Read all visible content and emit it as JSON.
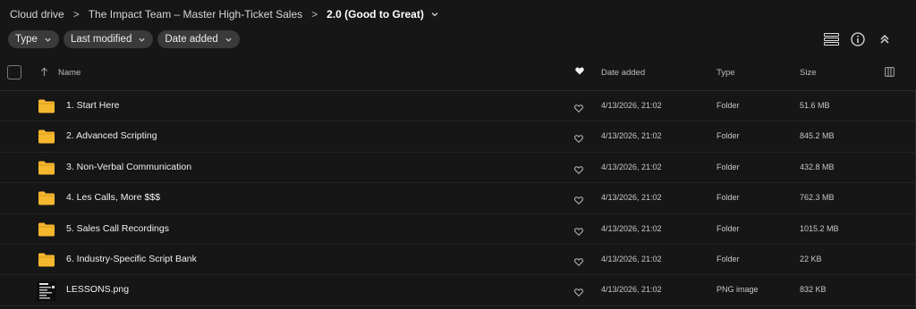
{
  "breadcrumb": {
    "items": [
      "Cloud drive",
      "The Impact Team – Master High-Ticket Sales"
    ],
    "current": "2.0 (Good to Great)",
    "separator": ">"
  },
  "filters": [
    {
      "label": "Type"
    },
    {
      "label": "Last modified"
    },
    {
      "label": "Date added"
    }
  ],
  "toolbar": {
    "icons": [
      "list-view-icon",
      "info-icon",
      "collapse-icon"
    ]
  },
  "table": {
    "columns": {
      "name": "Name",
      "date_added": "Date added",
      "type": "Type",
      "size": "Size"
    },
    "rows": [
      {
        "name": "1. Start Here",
        "date": "4/13/2026, 21:02",
        "type": "Folder",
        "size": "51.6 MB",
        "icon": "folder-icon"
      },
      {
        "name": "2. Advanced Scripting",
        "date": "4/13/2026, 21:02",
        "type": "Folder",
        "size": "845.2 MB",
        "icon": "folder-icon"
      },
      {
        "name": "3. Non-Verbal Communication",
        "date": "4/13/2026, 21:02",
        "type": "Folder",
        "size": "432.8 MB",
        "icon": "folder-icon"
      },
      {
        "name": "4. Les Calls, More $$$",
        "date": "4/13/2026, 21:02",
        "type": "Folder",
        "size": "762.3 MB",
        "icon": "folder-icon"
      },
      {
        "name": "5. Sales Call Recordings",
        "date": "4/13/2026, 21:02",
        "type": "Folder",
        "size": "1015.2 MB",
        "icon": "folder-icon"
      },
      {
        "name": "6. Industry-Specific Script Bank",
        "date": "4/13/2026, 21:02",
        "type": "Folder",
        "size": "22 KB",
        "icon": "folder-icon"
      },
      {
        "name": "LESSONS.png",
        "date": "4/13/2026, 21:02",
        "type": "PNG image",
        "size": "832 KB",
        "icon": "image-thumbnail-icon"
      }
    ]
  },
  "colors": {
    "background": "#161616",
    "chip": "#3a3a3a",
    "folder": "#f5b72e"
  }
}
